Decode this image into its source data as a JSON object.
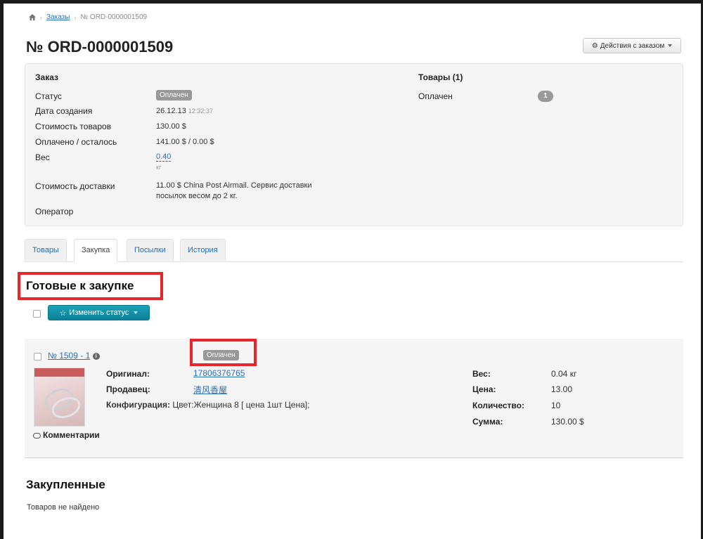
{
  "breadcrumb": {
    "home_icon": "home-icon",
    "orders": "Заказы",
    "current": "№ ORD-0000001509"
  },
  "order": {
    "title": "№ ORD-0000001509",
    "actions_label": "Действия с заказом"
  },
  "info": {
    "order_heading": "Заказ",
    "goods_heading": "Товары (1)",
    "status_label": "Статус",
    "status_value": "Оплачен",
    "created_label": "Дата создания",
    "created_date": "26.12.13",
    "created_time": "12:32:37",
    "goods_cost_label": "Стоимость товаров",
    "goods_cost_value": "130.00 $",
    "paid_label": "Оплачено / осталось",
    "paid_value": "141.00 $ / 0.00 $",
    "weight_label": "Вес",
    "weight_value": "0.40",
    "weight_unit": "кг",
    "delivery_label": "Стоимость доставки",
    "delivery_line1": "11.00 $ China Post Airmail. Сервис доставки",
    "delivery_line2": "посылок весом до 2 кг.",
    "operator_label": "Оператор",
    "goods_status_label": "Оплачен",
    "goods_status_count": "1"
  },
  "tabs": [
    {
      "label": "Товары",
      "active": false
    },
    {
      "label": "Закупка",
      "active": true
    },
    {
      "label": "Посылки",
      "active": false
    },
    {
      "label": "История",
      "active": false
    }
  ],
  "ready": {
    "title": "Готовые к закупке",
    "change_status_label": "Изменить статус"
  },
  "item": {
    "number_link": "№ 1509 - 1",
    "status": "Оплачен",
    "original_label": "Оригинал:",
    "original_value": "17806376765",
    "seller_label": "Продавец:",
    "seller_value": "清风香屋",
    "config_label": "Конфигурация:",
    "config_value": "Цвет:Женщина 8 [ цена 1шт Цена];",
    "comments_label": "Комментарии",
    "weight_label": "Вес:",
    "weight_value": "0.04 кг",
    "price_label": "Цена:",
    "price_value": "13.00",
    "qty_label": "Количество:",
    "qty_value": "10",
    "sum_label": "Сумма:",
    "sum_value": "130.00 $"
  },
  "purchased": {
    "title": "Закупленные",
    "empty_text": "Товаров не найдено"
  },
  "colors": {
    "accent_link": "#2a6db8",
    "highlight_red": "#e8252b",
    "primary_button": "#0b7f95",
    "badge_gray": "#999999"
  }
}
